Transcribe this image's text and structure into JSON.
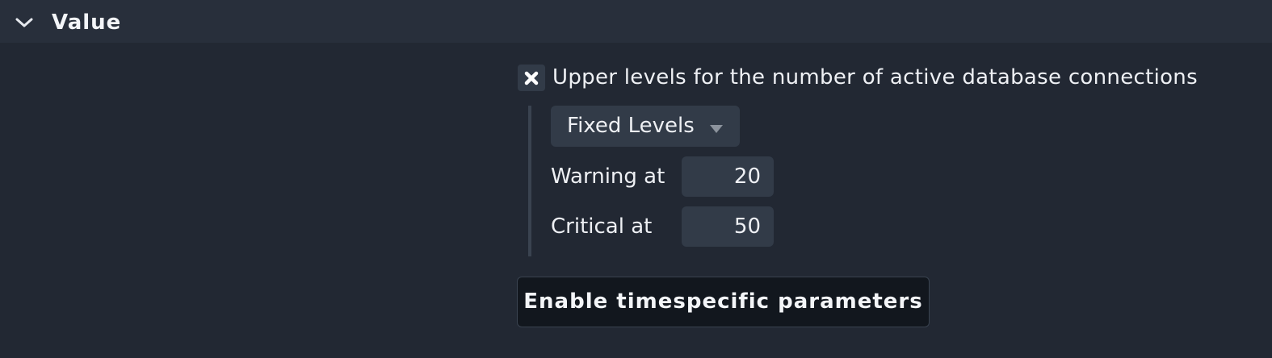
{
  "section": {
    "title": "Value",
    "toggle_icon": "chevron-down-icon"
  },
  "upper_levels": {
    "checked": true,
    "check_icon": "x-mark-icon",
    "label": "Upper levels for the number of active database connections",
    "levels_type": {
      "selected": "Fixed Levels",
      "arrow_icon": "caret-down-icon"
    },
    "warning": {
      "label": "Warning at",
      "value": "20"
    },
    "critical": {
      "label": "Critical at",
      "value": "50"
    }
  },
  "actions": {
    "enable_timespecific_label": "Enable timespecific parameters"
  },
  "colors": {
    "background": "#222833",
    "header_background": "#282f3b",
    "input_background": "#323b48",
    "button_background": "#12171e",
    "text": "#eef0f4"
  }
}
